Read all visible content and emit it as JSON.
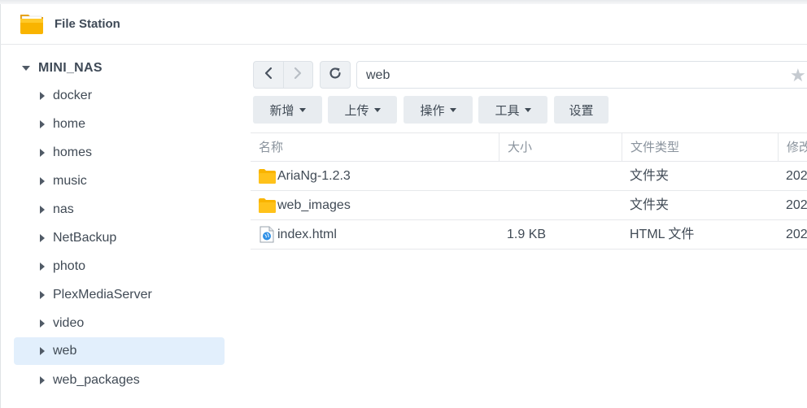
{
  "app": {
    "title": "File Station",
    "icon": "folder-app-icon"
  },
  "sidebar": {
    "root_label": "MINI_NAS",
    "items": [
      {
        "label": "docker",
        "selected": false
      },
      {
        "label": "home",
        "selected": false
      },
      {
        "label": "homes",
        "selected": false
      },
      {
        "label": "music",
        "selected": false
      },
      {
        "label": "nas",
        "selected": false
      },
      {
        "label": "NetBackup",
        "selected": false
      },
      {
        "label": "photo",
        "selected": false
      },
      {
        "label": "PlexMediaServer",
        "selected": false
      },
      {
        "label": "video",
        "selected": false
      },
      {
        "label": "web",
        "selected": true
      },
      {
        "label": "web_packages",
        "selected": false
      }
    ]
  },
  "navigation": {
    "path": "web",
    "back_icon": "chevron-left-icon",
    "forward_icon": "chevron-right-icon",
    "refresh_icon": "refresh-icon",
    "favorite_icon": "star-icon"
  },
  "toolbar": {
    "create_label": "新增",
    "upload_label": "上传",
    "action_label": "操作",
    "tools_label": "工具",
    "settings_label": "设置"
  },
  "table": {
    "columns": [
      "名称",
      "大小",
      "文件类型",
      "修改"
    ],
    "rows": [
      {
        "name": "AriaNg-1.2.3",
        "size": "",
        "type": "文件夹",
        "modified": "202",
        "icon": "folder-icon"
      },
      {
        "name": "web_images",
        "size": "",
        "type": "文件夹",
        "modified": "202",
        "icon": "folder-icon"
      },
      {
        "name": "index.html",
        "size": "1.9 KB",
        "type": "HTML 文件",
        "modified": "202",
        "icon": "html-file-icon"
      }
    ]
  },
  "colors": {
    "selected_bg": "#e2effc",
    "folder_yellow": "#f9b400",
    "button_bg": "#e8ecf0"
  }
}
